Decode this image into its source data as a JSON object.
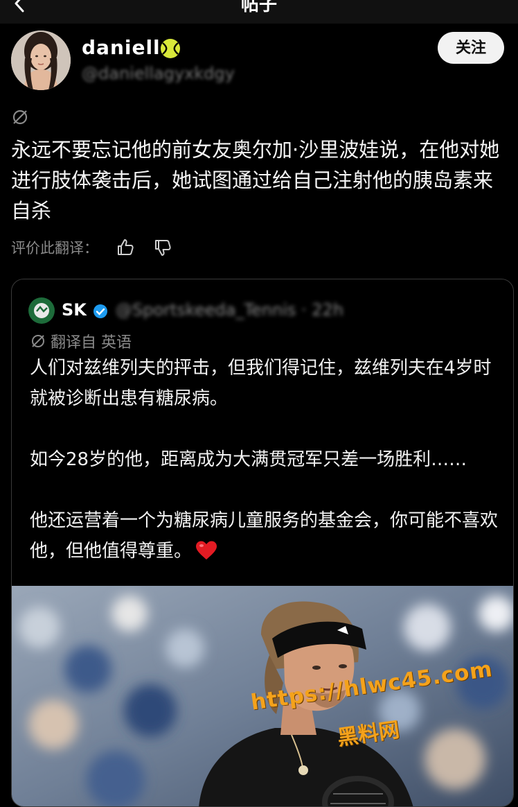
{
  "nav": {
    "title": "帖子",
    "back_icon": "chevron-left-icon"
  },
  "author": {
    "name": "daniella",
    "badge_icon": "tennis-ball-icon",
    "handle": "@daniellagyxkdgy",
    "follow_label": "关注"
  },
  "post": {
    "translate_icon": "translate-icon",
    "text": "永远不要忘记他的前女友奥尔加·沙里波娃说，在他对她进行肢体袭击后，她试图通过给自己注射他的胰岛素来自杀",
    "rate_label": "评价此翻译：",
    "thumbs_up_icon": "thumbs-up-icon",
    "thumbs_down_icon": "thumbs-down-icon"
  },
  "quote": {
    "name": "SK",
    "verified_icon": "verified-badge-icon",
    "handle": "@Sportskeeda_Tennis · 22h",
    "translated_from": "翻译自 英语",
    "paragraph1": "人们对兹维列夫的抨击，但我们得记住，兹维列夫在4岁时就被诊断出患有糖尿病。",
    "paragraph2": "如今28岁的他，距离成为大满贯冠军只差一场胜利……",
    "paragraph3": "他还运营着一个为糖尿病儿童服务的基金会，你可能不喜欢他，但他值得尊重。",
    "heart_icon": "red-heart-icon",
    "image_icon": "tennis-player-photo"
  },
  "watermark": {
    "url": "https://hlwc45.com",
    "name": "黑料网"
  },
  "colors": {
    "background": "#000000",
    "text": "#f2f2f2",
    "muted": "#8a8a8a",
    "follow_bg": "#f2f2f2",
    "watermark": "#f4a21b",
    "verified": "#1d9bf0"
  }
}
